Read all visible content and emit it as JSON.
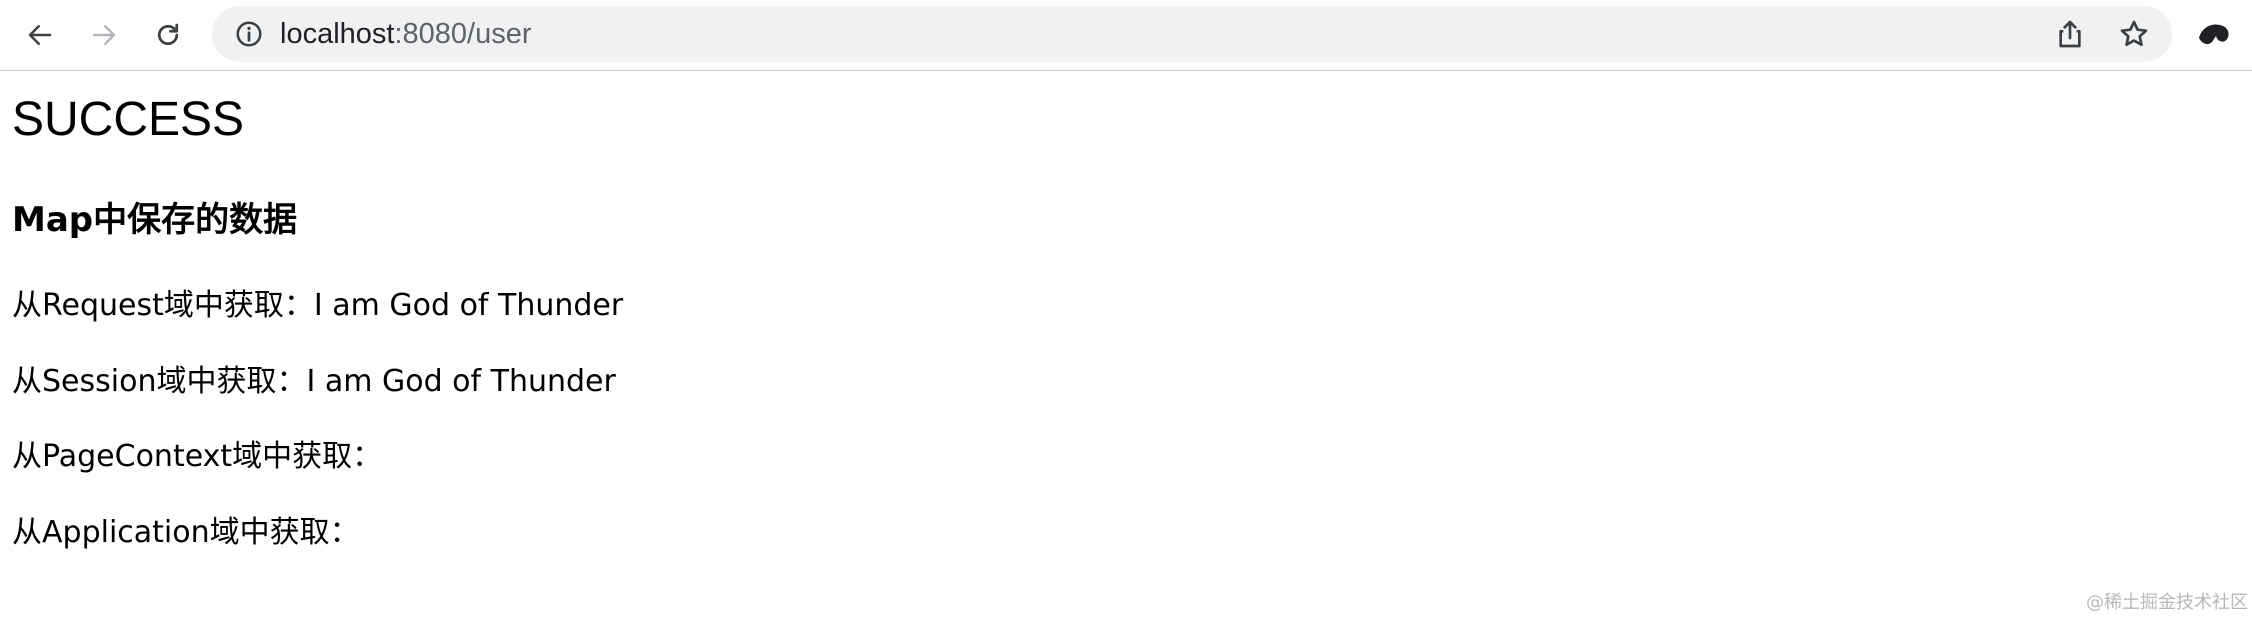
{
  "browser": {
    "url_host": "localhost",
    "url_rest": ":8080/user",
    "icons": {
      "back": "arrow-left-icon",
      "forward": "arrow-right-icon",
      "reload": "reload-icon",
      "site_info": "info-icon",
      "share": "share-icon",
      "bookmark": "star-icon",
      "profile": "profile-icon"
    }
  },
  "page": {
    "heading": "SUCCESS",
    "subheading": "Map中保存的数据",
    "lines": [
      "从Request域中获取：I am God of Thunder",
      "从Session域中获取：I am God of Thunder",
      "从PageContext域中获取：",
      "从Application域中获取："
    ]
  },
  "watermark": "@稀土掘金技术社区"
}
